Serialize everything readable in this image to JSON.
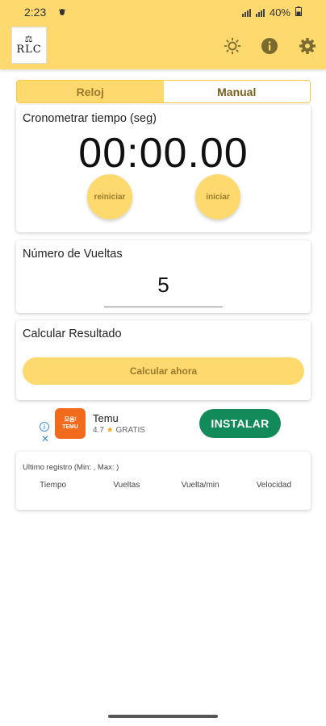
{
  "status_bar": {
    "time": "2:23",
    "notification_icon": "bug-icon",
    "battery": "40%"
  },
  "app_bar": {
    "logo_text": "RLC",
    "icons": [
      "brightness-icon",
      "info-icon",
      "settings-gear-icon"
    ]
  },
  "tabs": [
    {
      "label": "Reloj",
      "active": true
    },
    {
      "label": "Manual",
      "active": false
    }
  ],
  "timer_card": {
    "title": "Cronometrar tiempo (seg)",
    "value": "00:00.00",
    "reset_label": "reiniciar",
    "start_label": "iniciar"
  },
  "laps_card": {
    "title": "Número de Vueltas",
    "value": "5"
  },
  "calc_card": {
    "title": "Calcular Resultado",
    "button_label": "Calcular ahora"
  },
  "ad": {
    "logo_line1": "모음/",
    "logo_line2": "TEMU",
    "app_name": "Temu",
    "rating": "4.7",
    "price": "GRATIS",
    "install_label": "INSTALAR"
  },
  "record_card": {
    "title": "Ultimo registro (Min: , Max: )",
    "columns": [
      "Tiempo",
      "Vueltas",
      "Vuelta/min",
      "Velocidad"
    ]
  },
  "colors": {
    "accent": "#fdd96e",
    "accent_text": "#9a7b2c",
    "install_green": "#138a5a"
  }
}
